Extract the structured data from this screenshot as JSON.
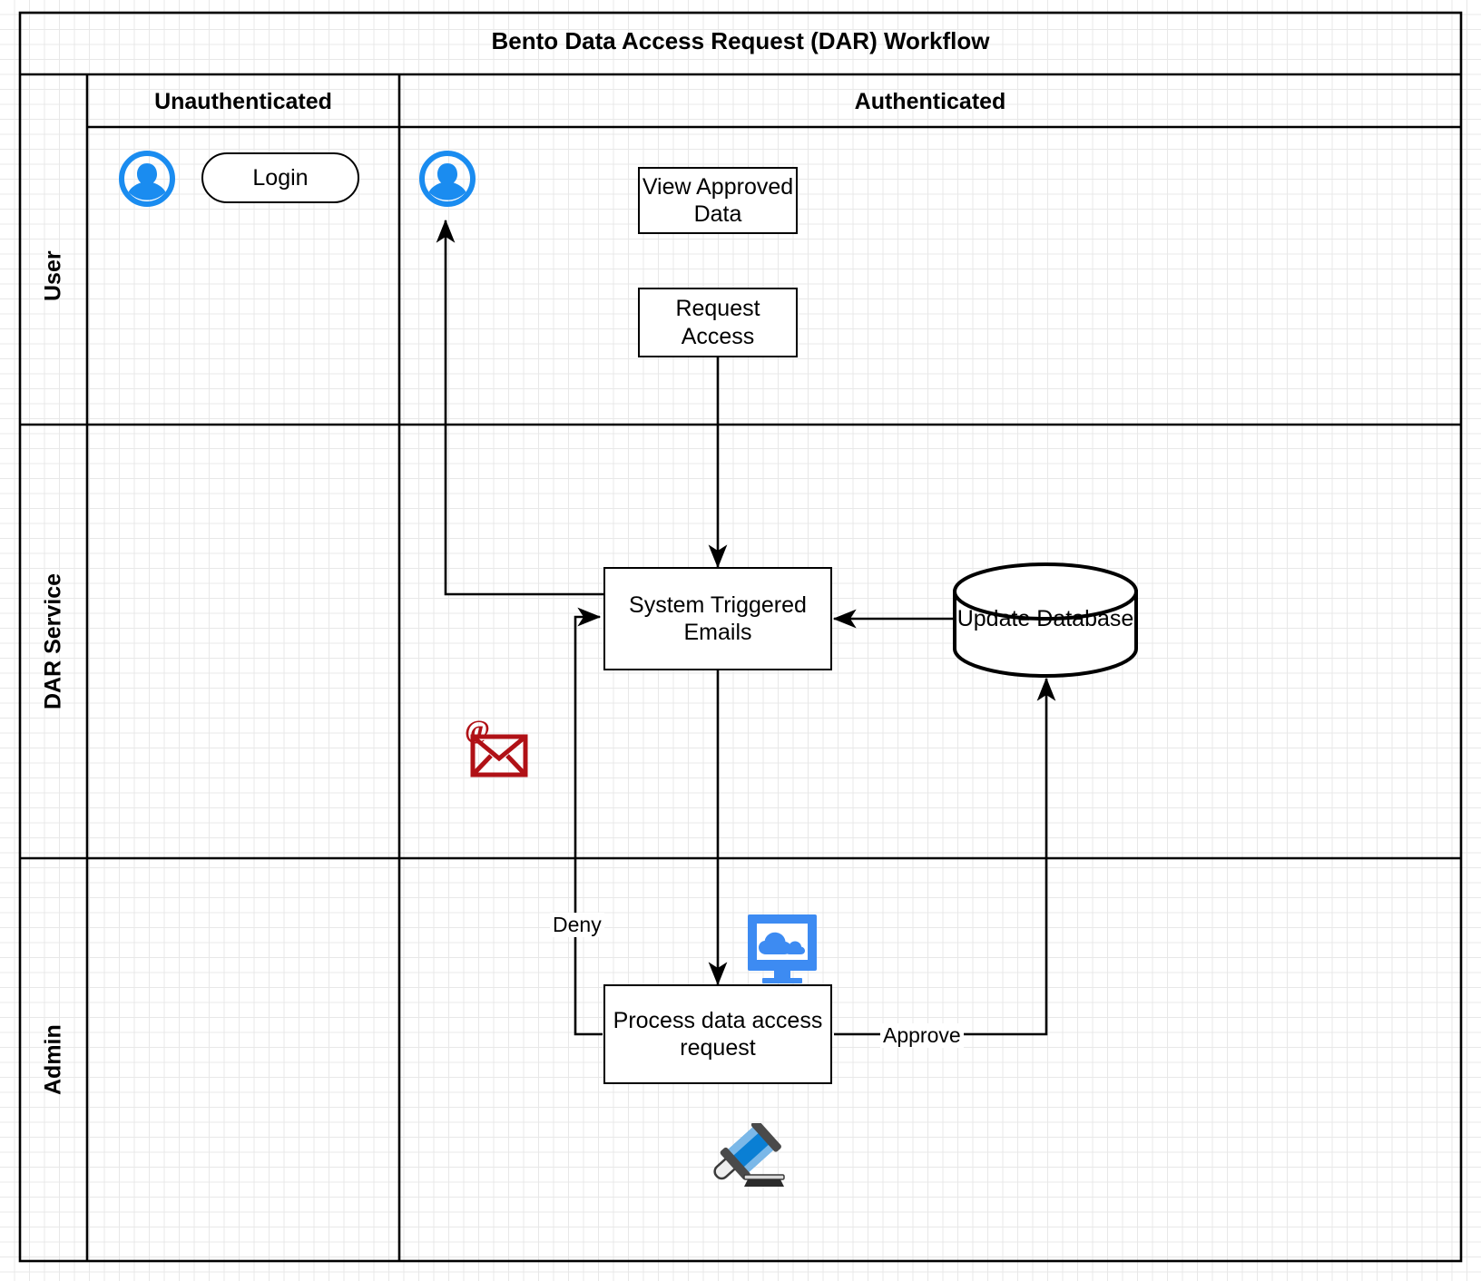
{
  "diagram": {
    "title": "Bento Data Access Request (DAR) Workflow",
    "type": "swimlane-flowchart",
    "colors": {
      "accent_blue": "#3d8bf2",
      "user_icon_blue": "#1a8cf0",
      "email_red": "#b01116",
      "line_black": "#000000",
      "grid_minor": "#e8e8e8",
      "grid_major": "#cfcfcf",
      "background": "#ffffff"
    }
  },
  "columns": [
    {
      "id": "unauthenticated",
      "label": "Unauthenticated"
    },
    {
      "id": "authenticated",
      "label": "Authenticated"
    }
  ],
  "lanes": [
    {
      "id": "user",
      "label": "User"
    },
    {
      "id": "dar-service",
      "label": "DAR Service"
    },
    {
      "id": "admin",
      "label": "Admin"
    }
  ],
  "nodes": {
    "login": {
      "label": "Login",
      "shape": "pill",
      "lane": "user",
      "column": "unauthenticated"
    },
    "view_approved_data": {
      "label": "View Approved Data",
      "shape": "process",
      "lane": "user",
      "column": "authenticated"
    },
    "request_access": {
      "label": "Request Access",
      "shape": "process",
      "lane": "user",
      "column": "authenticated"
    },
    "system_triggered_emails": {
      "label": "System Triggered Emails",
      "shape": "process",
      "lane": "dar-service",
      "column": "authenticated"
    },
    "update_database": {
      "label": "Update Database",
      "shape": "cylinder",
      "lane": "dar-service",
      "column": "authenticated"
    },
    "process_data_access_request": {
      "label": "Process data access request",
      "shape": "process",
      "lane": "admin",
      "column": "authenticated"
    }
  },
  "edge_labels": {
    "deny": "Deny",
    "approve": "Approve"
  },
  "icons": {
    "user_unauthenticated": "user-avatar-icon",
    "user_authenticated": "user-avatar-icon",
    "email": "email-at-envelope-icon",
    "cloud_monitor": "cloud-monitor-icon",
    "gavel": "gavel-icon"
  }
}
